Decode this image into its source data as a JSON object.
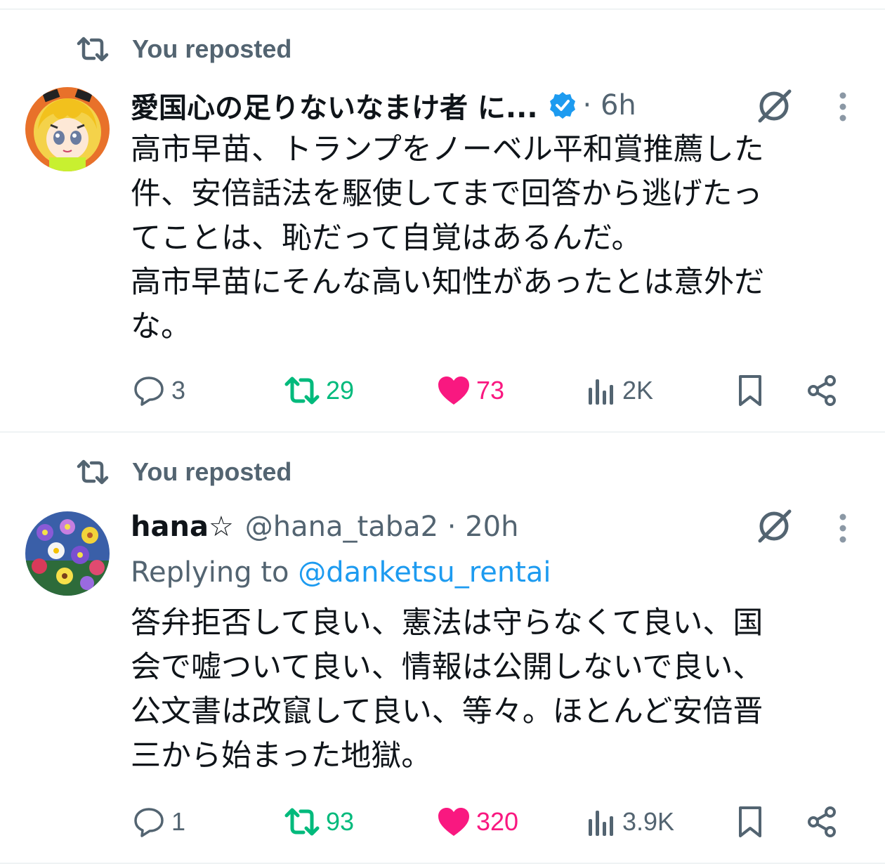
{
  "posts": [
    {
      "repost_label": "You reposted",
      "author_name": "愛国心の足りないなまけ者 に...",
      "verified": true,
      "meta": "· 6h",
      "body": "高市早苗、トランプをノーベル平和賞推薦した\n件、安倍話法を駆使してまで回答から逃げたっ\nてことは、恥だって自覚はあるんだ。\n高市早苗にそんな高い知性があったとは意外だ\nな。",
      "counts": {
        "reply": "3",
        "repost": "29",
        "like": "73",
        "views": "2K"
      }
    },
    {
      "repost_label": "You reposted",
      "author_name": "hana☆",
      "meta": "@hana_taba2 · 20h",
      "reply_prefix": "Replying to ",
      "reply_handle": "@danketsu_rentai",
      "body": "答弁拒否して良い、憲法は守らなくて良い、国\n会で嘘ついて良い、情報は公開しないで良い、\n公文書は改竄して良い、等々。ほとんど安倍晋\n三から始まった地獄。",
      "counts": {
        "reply": "1",
        "repost": "93",
        "like": "320",
        "views": "3.9K"
      }
    }
  ],
  "icons": {
    "repost": "repost-icon",
    "verified": "verified-badge-icon",
    "grok": "grok-icon",
    "more": "more-vertical-icon",
    "reply": "reply-icon",
    "like": "heart-icon",
    "views": "views-icon",
    "bookmark": "bookmark-icon",
    "share": "share-icon"
  },
  "colors": {
    "text": "#0f1419",
    "secondary": "#536471",
    "link": "#1d9bf0",
    "repost_active": "#00ba7c",
    "like_active": "#f91880",
    "verified": "#1d9bf0"
  }
}
